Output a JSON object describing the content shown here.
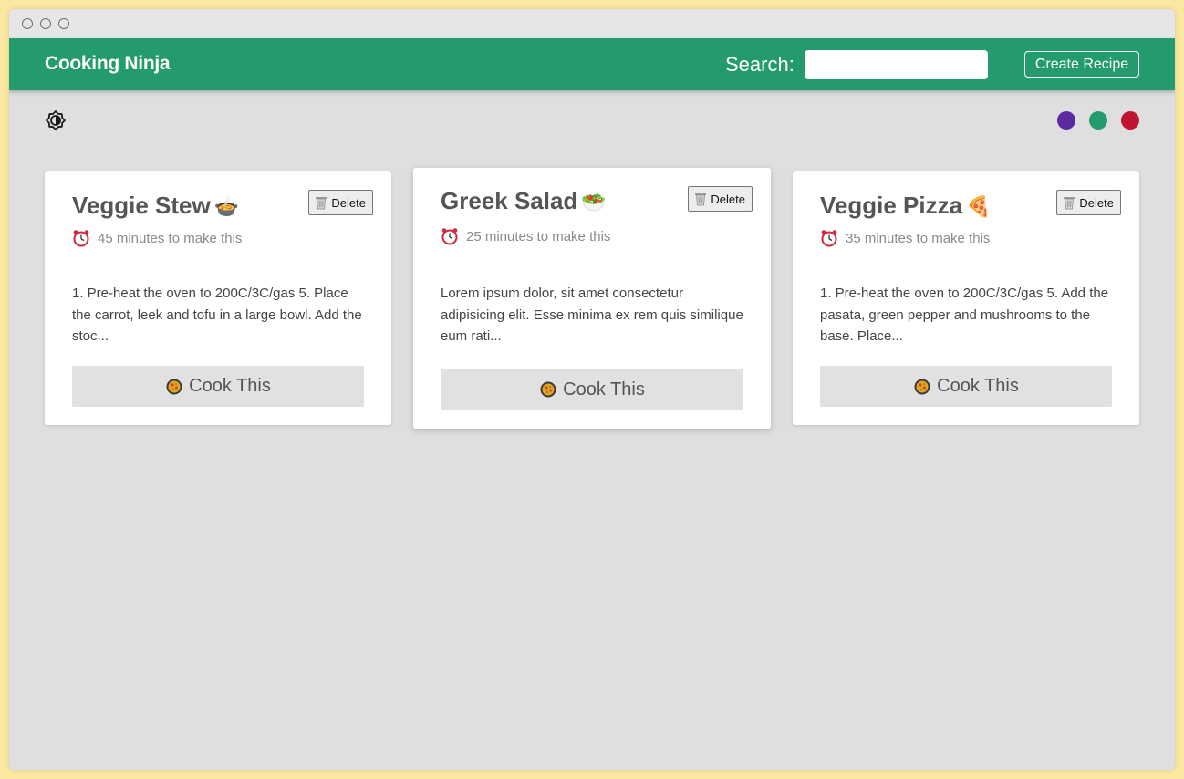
{
  "navbar": {
    "brand": "Cooking Ninja",
    "search_label": "Search:",
    "search_value": "",
    "create_label": "Create Recipe",
    "color": "#249b6c"
  },
  "themes": [
    {
      "name": "purple",
      "color": "#5b2aa0"
    },
    {
      "name": "green",
      "color": "#249b6c"
    },
    {
      "name": "red",
      "color": "#c0152f"
    }
  ],
  "recipes": [
    {
      "title": "Veggie Stew",
      "emoji_icon": "stew-bowl-icon",
      "time": "45 minutes to make this",
      "method": "1. Pre-heat the oven to 200C/3C/gas 5. Place the carrot, leek and tofu in a large bowl. Add the stoc...",
      "delete_label": "Delete",
      "cook_label": "Cook This"
    },
    {
      "title": "Greek Salad",
      "emoji_icon": "salad-bowl-icon",
      "time": "25 minutes to make this",
      "method": "Lorem ipsum dolor, sit amet consectetur adipisicing elit. Esse minima ex rem quis similique eum rati...",
      "delete_label": "Delete",
      "cook_label": "Cook This"
    },
    {
      "title": "Veggie Pizza",
      "emoji_icon": "pizza-slice-icon",
      "time": "35 minutes to make this",
      "method": "1. Pre-heat the oven to 200C/3C/gas 5. Add the pasata, green pepper and mushrooms to the base. Place...",
      "delete_label": "Delete",
      "cook_label": "Cook This"
    }
  ]
}
